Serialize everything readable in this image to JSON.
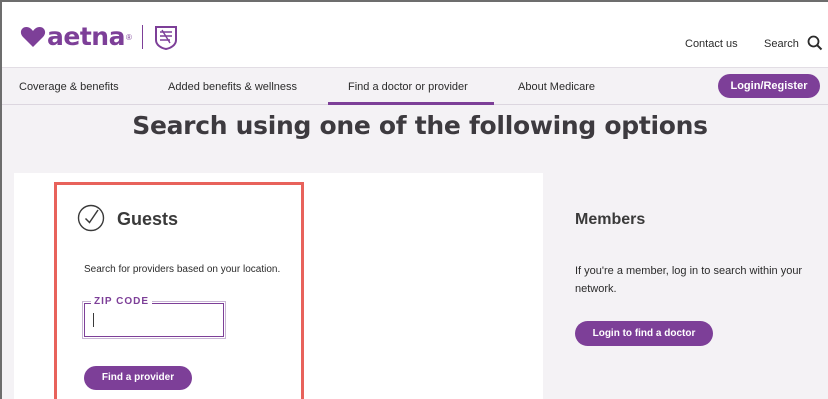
{
  "header": {
    "logo_text": "aetna",
    "logo_reg": "®",
    "contact_label": "Contact us",
    "search_label": "Search",
    "icons": [
      "heart-logo-icon",
      "cvs-health-badge-icon",
      "search-icon"
    ]
  },
  "nav": {
    "items": [
      {
        "label": "Coverage & benefits"
      },
      {
        "label": "Added benefits & wellness"
      },
      {
        "label": "Find a doctor or provider"
      },
      {
        "label": "About Medicare"
      }
    ],
    "active_index": 2,
    "login_label": "Login/Register"
  },
  "main": {
    "headline": "Search using one of the following options",
    "guests": {
      "title": "Guests",
      "description": "Search for providers based on your location.",
      "zip_label": "ZIP CODE",
      "zip_value": "",
      "button_label": "Find a provider"
    },
    "members": {
      "title": "Members",
      "description": "If you're a member, log in to search within your network.",
      "button_label": "Login to find a doctor"
    }
  },
  "colors": {
    "brand_purple": "#7d3f98",
    "highlight_red": "#e8625b",
    "panel_bg": "#f4f2f5"
  }
}
